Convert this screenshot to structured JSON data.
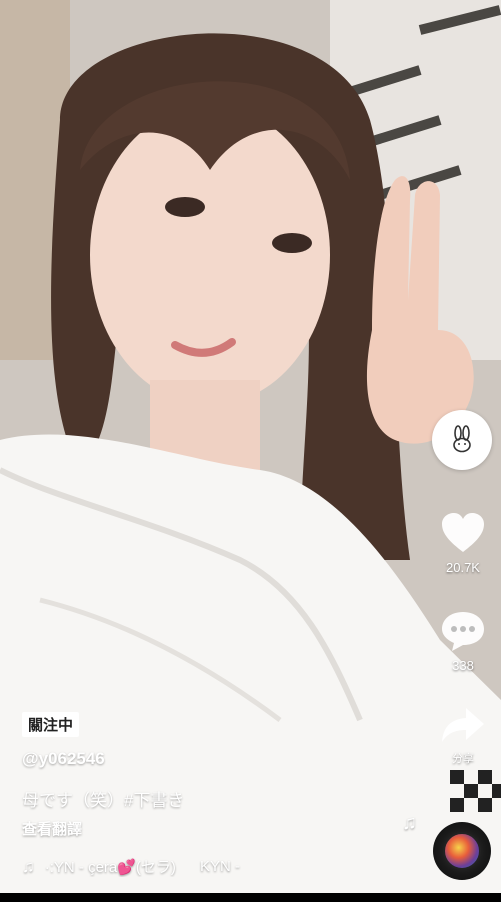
{
  "profile": {
    "follow_badge": "關注中",
    "username": "@y062546",
    "caption": "母です（笑）#下書き",
    "translate_label": "查看翻譯"
  },
  "music": {
    "note_icon": "music-note-icon",
    "track_text_1": "·:YN - çera💕(セラ)",
    "track_text_2": "KYN -"
  },
  "actions": {
    "avatar_icon": "bunny-icon",
    "like_icon": "heart-icon",
    "like_count": "20.7K",
    "comment_icon": "comment-bubble-icon",
    "comment_count": "338",
    "share_icon": "share-arrow-icon",
    "share_label": "分享"
  },
  "colors": {
    "text": "#ffffff",
    "badge_bg": "#ffffff",
    "badge_text": "#222222"
  }
}
